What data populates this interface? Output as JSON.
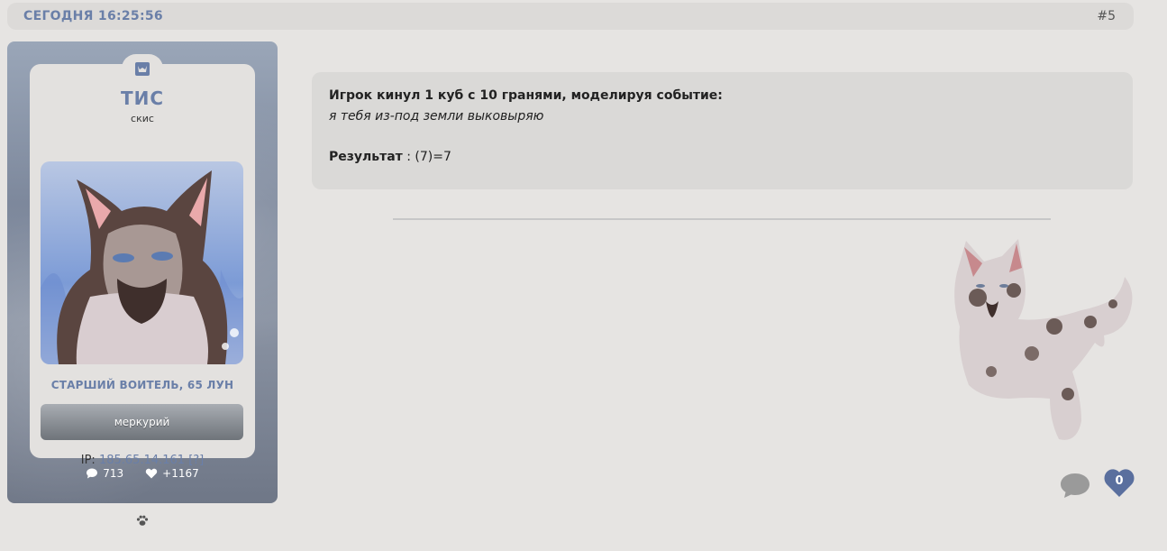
{
  "header": {
    "date": "СЕГОДНЯ 16:25:56",
    "post_number": "#5"
  },
  "profile": {
    "username": "ТИС",
    "title": "скис",
    "rank": "СТАРШИЙ ВОИТЕЛЬ, 65 ЛУН",
    "tag": "меркурий",
    "ip_label": "IP:",
    "ip_value": "185.65.14.161 [?]",
    "posts_count": "713",
    "reputation": "+1167"
  },
  "post": {
    "dice_title": "Игрок кинул 1 куб с 10 гранями, моделируя событие:",
    "dice_event": "я тебя из-под земли выковыряю",
    "result_label": "Результат",
    "result_value": " : (7)=7"
  },
  "actions": {
    "like_count": "0"
  },
  "colors": {
    "accent": "#6a7fa8",
    "like": "#5a6f9e",
    "comment": "#9a9a9a",
    "background": "#e6e4e2"
  },
  "icons": {
    "rank": "cat-head-icon",
    "posts": "speech-bubble-icon",
    "reputation": "heart-icon",
    "paw": "paw-icon",
    "comment": "comment-icon",
    "like": "heart-icon"
  }
}
